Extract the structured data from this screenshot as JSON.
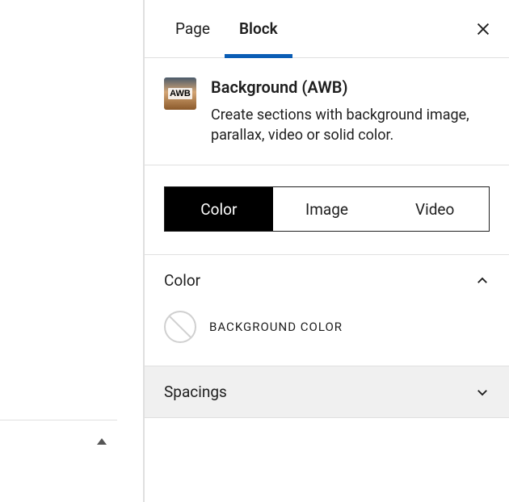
{
  "tabs": {
    "page": "Page",
    "block": "Block"
  },
  "block": {
    "icon_text": "AWB",
    "title": "Background (AWB)",
    "description": "Create sections with background image, parallax, video or solid color."
  },
  "type_toggle": {
    "color": "Color",
    "image": "Image",
    "video": "Video"
  },
  "panels": {
    "color": {
      "title": "Color",
      "bg_color_label": "BACKGROUND COLOR"
    },
    "spacings": {
      "title": "Spacings"
    }
  }
}
